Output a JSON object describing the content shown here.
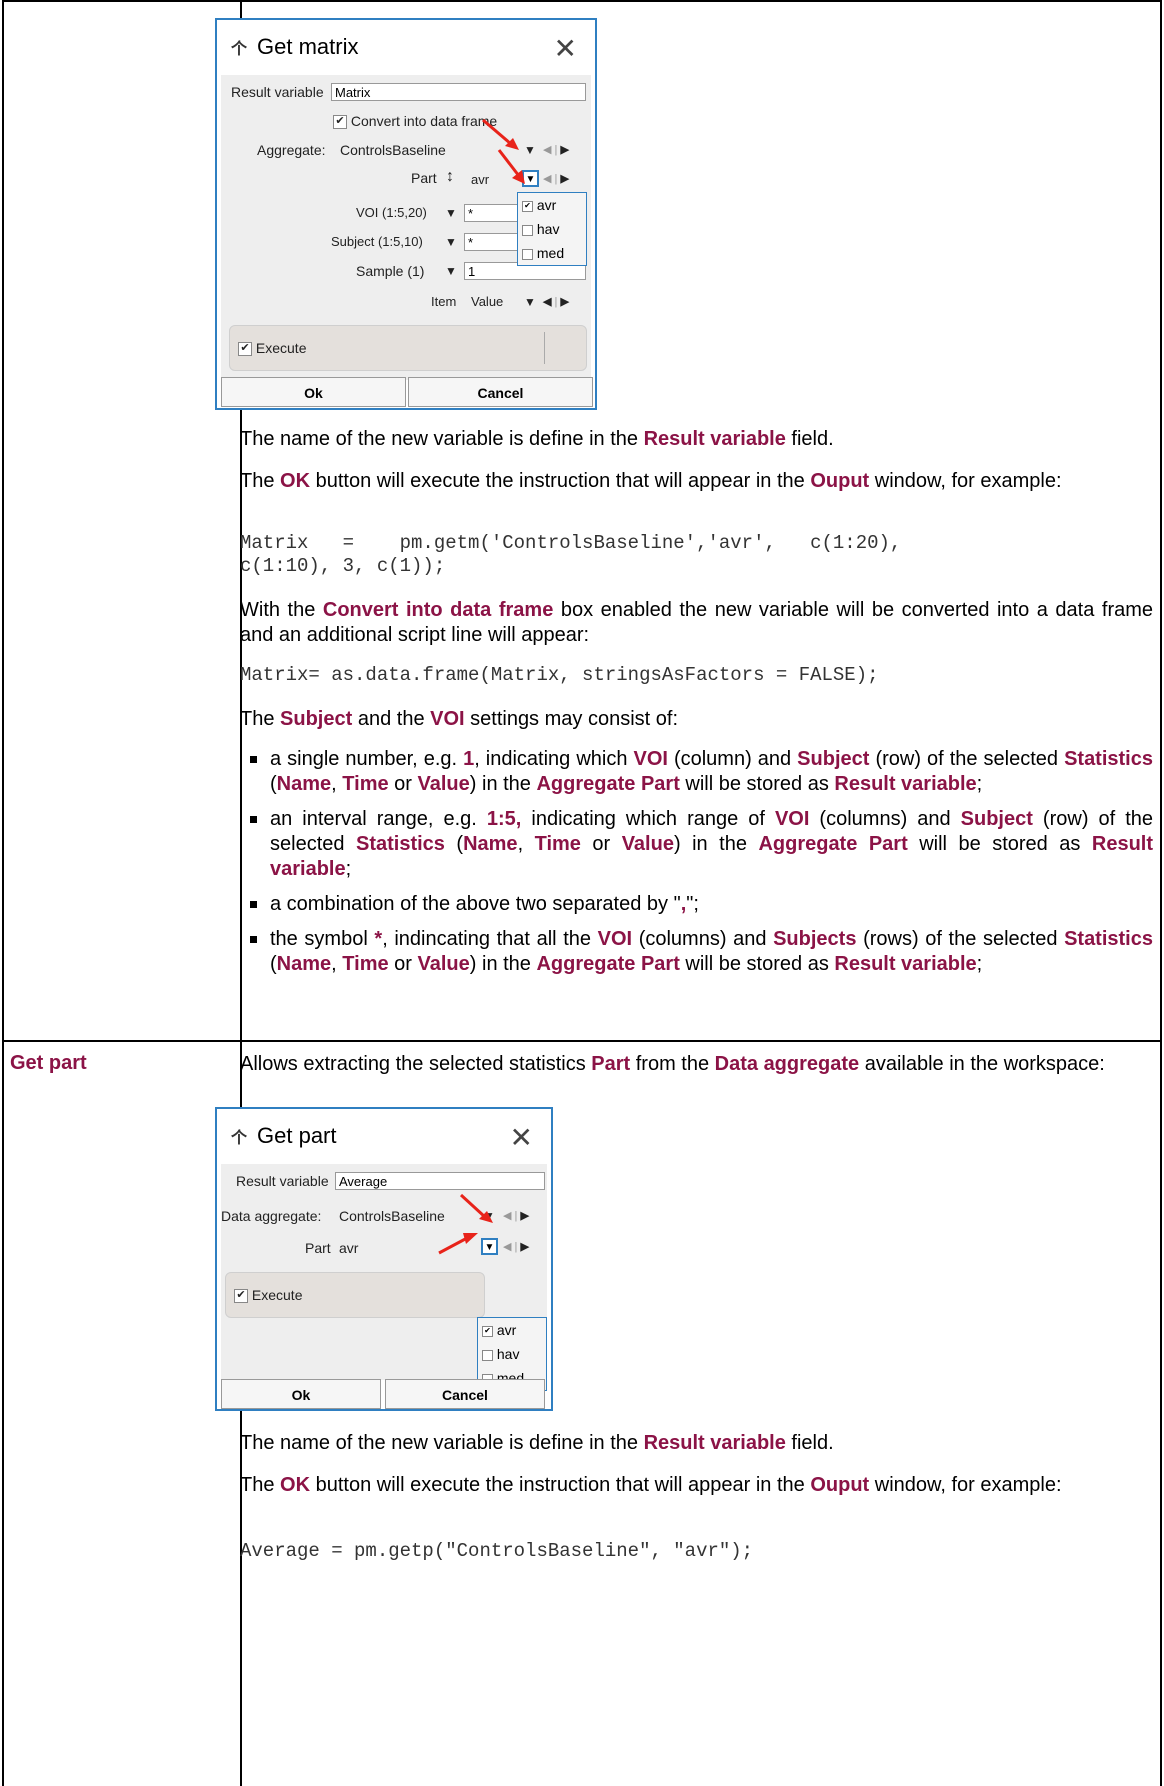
{
  "colors": {
    "keyword": "#8B1346",
    "dialog_border": "#2F7FC1",
    "arrow": "#E8231A"
  },
  "get_matrix_dialog": {
    "title": "Get matrix",
    "result_variable_label": "Result variable",
    "result_variable_value": "Matrix",
    "convert_label": "Convert into data frame",
    "aggregate_label": "Aggregate:",
    "aggregate_value": "ControlsBaseline",
    "part_label": "Part",
    "part_value": "avr",
    "voi_label": "VOI (1:5,20)",
    "voi_value": "*",
    "subject_label": "Subject (1:5,10)",
    "subject_value": "*",
    "sample_label": "Sample (1)",
    "sample_value": "1",
    "item_label": "Item",
    "item_value": "Value",
    "part_options": [
      "avr",
      "hav",
      "med"
    ],
    "execute_label": "Execute",
    "ok_label": "Ok",
    "cancel_label": "Cancel"
  },
  "matrix_text": {
    "p1_pre": "The name of the new variable is define in the ",
    "p1_kw": "Result variable",
    "p1_post": " field.",
    "p2_a": "The ",
    "p2_kw1": "OK",
    "p2_b": " button will execute the instruction that will appear in the ",
    "p2_kw2": "Ouput",
    "p2_c": " window, for example:",
    "code1_line1": "Matrix   =    pm.getm('ControlsBaseline','avr',   c(1:20),",
    "code1_line2": "c(1:10), 3, c(1));",
    "p3_a": "With the ",
    "p3_kw": "Convert into data frame",
    "p3_b": " box enabled the new variable will be converted into a data frame and an additional script line will appear:",
    "code2": "Matrix= as.data.frame(Matrix, stringsAsFactors = FALSE);",
    "p4_a": "The ",
    "p4_kw1": "Subject",
    "p4_b": " and the ",
    "p4_kw2": "VOI",
    "p4_c": " settings may consist of:"
  },
  "bullets": {
    "b1": [
      "a single number, e.g. ",
      "1",
      ", indicating which ",
      "VOI",
      " (column) and ",
      "Subject",
      " (row) of the selected ",
      "Statistics",
      " (",
      "Name",
      ", ",
      "Time",
      " or ",
      "Value",
      ") in the ",
      "Aggregate Part",
      " will be stored as ",
      "Result variable",
      ";"
    ],
    "b2": [
      "an interval range, e.g. ",
      "1:5,",
      " indicating which range of ",
      "VOI",
      " (columns) and ",
      "Subject",
      " (row) of the selected ",
      "Statistics",
      " (",
      "Name",
      ", ",
      "Time",
      " or ",
      "Value",
      ") in the ",
      "Aggregate Part",
      " will be stored as ",
      "Result variable",
      ";"
    ],
    "b3": [
      "a combination of the above two separated by \"",
      ",",
      "\";"
    ],
    "b4": [
      "the symbol ",
      "*",
      ", indincating that all the ",
      "VOI",
      " (columns) and ",
      "Subjects",
      " (rows) of the selected ",
      "Statistics",
      " (",
      "Name",
      ", ",
      "Time",
      " or ",
      "Value",
      ") in the ",
      "Aggregate Part",
      " will be stored as ",
      "Result variable",
      ";"
    ]
  },
  "get_part_row": {
    "label": "Get part",
    "intro_a": "Allows extracting the selected statistics ",
    "intro_kw1": "Part",
    "intro_b": " from the ",
    "intro_kw2": "Data aggregate",
    "intro_c": " available in the workspace:"
  },
  "get_part_dialog": {
    "title": "Get part",
    "result_variable_label": "Result variable",
    "result_variable_value": "Average",
    "aggregate_label": "Data aggregate:",
    "aggregate_value": "ControlsBaseline",
    "part_label": "Part",
    "part_value": "avr",
    "part_options": [
      "avr",
      "hav",
      "med"
    ],
    "execute_label": "Execute",
    "ok_label": "Ok",
    "cancel_label": "Cancel"
  },
  "part_text": {
    "p1_pre": "The name of the new variable is define in the ",
    "p1_kw": "Result variable",
    "p1_post": " field.",
    "p2_a": "The ",
    "p2_kw1": "OK",
    "p2_b": " button will execute the instruction that will appear in the ",
    "p2_kw2": "Ouput",
    "p2_c": " window, for example:",
    "code": "Average = pm.getp(\"ControlsBaseline\", \"avr\");"
  }
}
